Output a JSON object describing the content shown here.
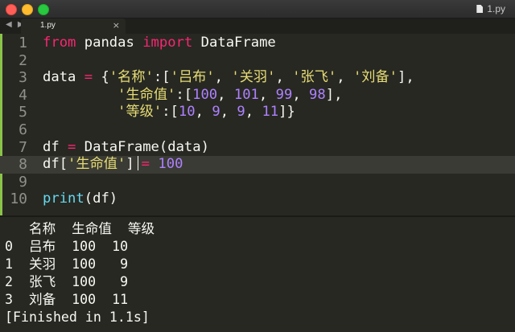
{
  "window": {
    "title": "1.py",
    "icon": "document-icon"
  },
  "tabbar": {
    "nav": "◀ ▶",
    "tab_label": "1.py",
    "close": "×"
  },
  "colors": {
    "keyword": "#f92672",
    "string": "#e6db74",
    "number": "#ae81ff",
    "function": "#66d9ef",
    "text": "#f8f8f2",
    "background": "#272822",
    "gutter": "#8bc34a"
  },
  "code_lines": [
    {
      "n": "1",
      "tokens": [
        [
          "kw",
          "from"
        ],
        [
          "pl",
          " pandas "
        ],
        [
          "kw",
          "import"
        ],
        [
          "pl",
          " DataFrame"
        ]
      ]
    },
    {
      "n": "2",
      "tokens": []
    },
    {
      "n": "3",
      "tokens": [
        [
          "pl",
          "data "
        ],
        [
          "kw",
          "="
        ],
        [
          "pl",
          " {"
        ],
        [
          "st",
          "'名称'"
        ],
        [
          "pl",
          ":["
        ],
        [
          "st",
          "'吕布'"
        ],
        [
          "pl",
          ", "
        ],
        [
          "st",
          "'关羽'"
        ],
        [
          "pl",
          ", "
        ],
        [
          "st",
          "'张飞'"
        ],
        [
          "pl",
          ", "
        ],
        [
          "st",
          "'刘备'"
        ],
        [
          "pl",
          "],"
        ]
      ]
    },
    {
      "n": "4",
      "tokens": [
        [
          "pl",
          "         "
        ],
        [
          "st",
          "'生命值'"
        ],
        [
          "pl",
          ":["
        ],
        [
          "nm",
          "100"
        ],
        [
          "pl",
          ", "
        ],
        [
          "nm",
          "101"
        ],
        [
          "pl",
          ", "
        ],
        [
          "nm",
          "99"
        ],
        [
          "pl",
          ", "
        ],
        [
          "nm",
          "98"
        ],
        [
          "pl",
          "],"
        ]
      ]
    },
    {
      "n": "5",
      "tokens": [
        [
          "pl",
          "         "
        ],
        [
          "st",
          "'等级'"
        ],
        [
          "pl",
          ":["
        ],
        [
          "nm",
          "10"
        ],
        [
          "pl",
          ", "
        ],
        [
          "nm",
          "9"
        ],
        [
          "pl",
          ", "
        ],
        [
          "nm",
          "9"
        ],
        [
          "pl",
          ", "
        ],
        [
          "nm",
          "11"
        ],
        [
          "pl",
          "]}"
        ]
      ]
    },
    {
      "n": "6",
      "tokens": []
    },
    {
      "n": "7",
      "tokens": [
        [
          "pl",
          "df "
        ],
        [
          "kw",
          "="
        ],
        [
          "pl",
          " DataFrame(data)"
        ]
      ]
    },
    {
      "n": "8",
      "tokens": [
        [
          "pl",
          "df["
        ],
        [
          "st",
          "'生命值'"
        ],
        [
          "pl",
          "]"
        ],
        [
          "cursor",
          ""
        ],
        [
          "kw",
          "="
        ],
        [
          "pl",
          " "
        ],
        [
          "nm",
          "100"
        ]
      ],
      "active": true
    },
    {
      "n": "9",
      "tokens": []
    },
    {
      "n": "10",
      "tokens": [
        [
          "fn",
          "print"
        ],
        [
          "pl",
          "(df)"
        ]
      ]
    }
  ],
  "output": {
    "lines": [
      "   名称  生命值  等级",
      "0  吕布  100  10",
      "1  关羽  100   9",
      "2  张飞  100   9",
      "3  刘备  100  11",
      "[Finished in 1.1s]"
    ]
  }
}
